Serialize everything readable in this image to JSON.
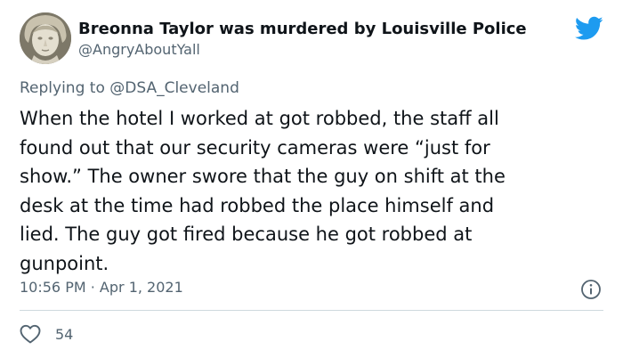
{
  "header": {
    "display_name": "Breonna Taylor was murdered by Louisville Police",
    "handle": "@AngryAboutYall",
    "avatar_icon": "statue-avatar",
    "brand_icon": "twitter-bird-icon",
    "brand_color": "#1d9bf0"
  },
  "reply": {
    "prefix": "Replying to ",
    "mention": "@DSA_Cleveland"
  },
  "tweet": {
    "text": "When the hotel I worked at got robbed, the staff all\nfound out that our security cameras were “just for\nshow.” The owner swore that the guy on shift at the\ndesk at the time had robbed the place himself and\nlied. The guy got fired because he got robbed at\ngunpoint."
  },
  "meta": {
    "time": "10:56 PM",
    "separator": " · ",
    "date": "Apr 1, 2021"
  },
  "actions": {
    "like_count": "54",
    "like_icon": "heart-icon",
    "info_icon": "info-icon"
  }
}
